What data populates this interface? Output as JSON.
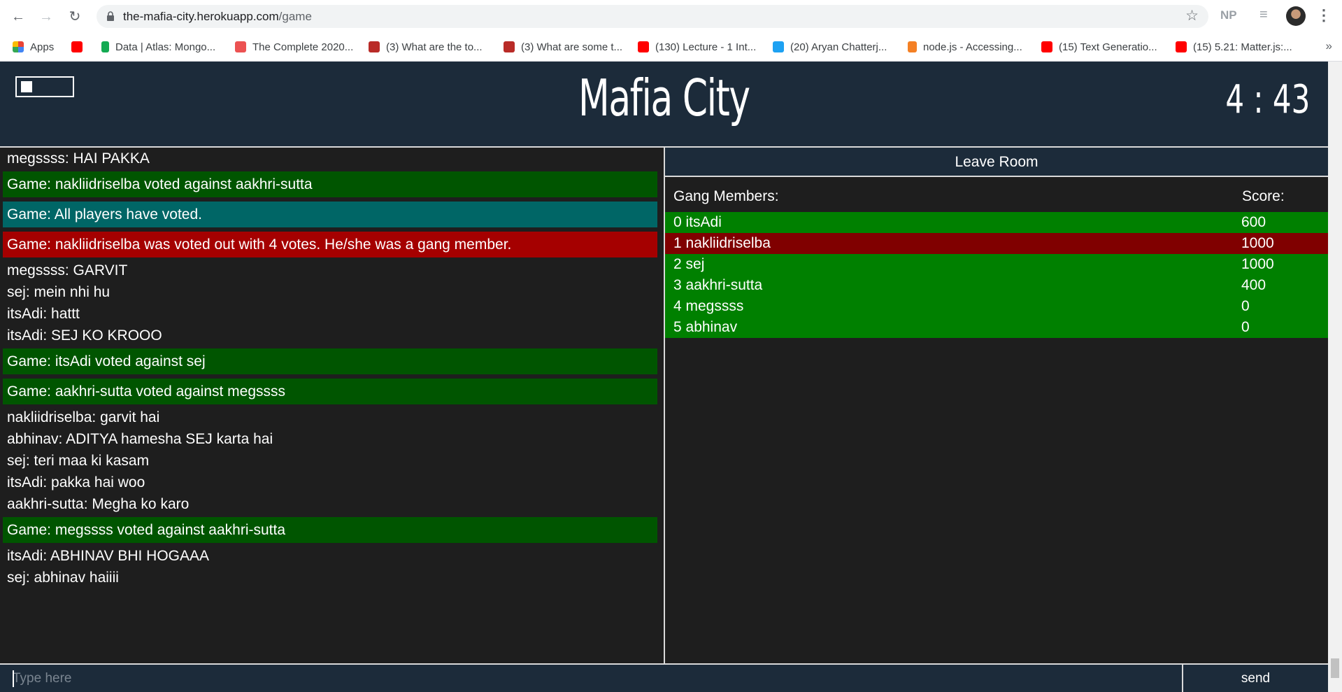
{
  "browser": {
    "url_host": "the-mafia-city.herokuapp.com",
    "url_path": "/game",
    "extension_np": "NP",
    "bookmarks": [
      {
        "label": "Apps",
        "icon": "apps-grid-icon"
      },
      {
        "label": "",
        "icon": "youtube-icon"
      },
      {
        "label": "Data | Atlas: Mongo...",
        "icon": "mongodb-leaf-icon"
      },
      {
        "label": "The Complete 2020...",
        "icon": "udemy-icon"
      },
      {
        "label": "(3) What are the to...",
        "icon": "quora-icon"
      },
      {
        "label": "(3) What are some t...",
        "icon": "quora-icon"
      },
      {
        "label": "(130) Lecture - 1 Int...",
        "icon": "youtube-icon"
      },
      {
        "label": "(20) Aryan Chatterj...",
        "icon": "twitter-icon"
      },
      {
        "label": "node.js - Accessing...",
        "icon": "stackoverflow-icon"
      },
      {
        "label": "(15) Text Generatio...",
        "icon": "youtube-icon"
      },
      {
        "label": "(15) 5.21: Matter.js:...",
        "icon": "youtube-icon"
      }
    ],
    "more": "»"
  },
  "header": {
    "title": "Mafia City",
    "timer": "4 : 43"
  },
  "chat": {
    "messages": [
      {
        "kind": "plain",
        "text": "megssss: HAI PAKKA"
      },
      {
        "kind": "vote",
        "text": "Game: nakliidriselba voted against aakhri-sutta"
      },
      {
        "kind": "info",
        "text": "Game: All players have voted."
      },
      {
        "kind": "out",
        "text": "Game: nakliidriselba was voted out with 4 votes. He/she was a gang member."
      },
      {
        "kind": "plain",
        "text": "megssss: GARVIT"
      },
      {
        "kind": "plain",
        "text": "sej: mein nhi hu"
      },
      {
        "kind": "plain",
        "text": "itsAdi: hattt"
      },
      {
        "kind": "plain",
        "text": "itsAdi: SEJ KO KROOO"
      },
      {
        "kind": "vote",
        "text": "Game: itsAdi voted against sej"
      },
      {
        "kind": "vote",
        "text": "Game: aakhri-sutta voted against megssss"
      },
      {
        "kind": "plain",
        "text": "nakliidriselba: garvit hai"
      },
      {
        "kind": "plain",
        "text": "abhinav: ADITYA hamesha SEJ karta hai"
      },
      {
        "kind": "plain",
        "text": "sej: teri maa ki kasam"
      },
      {
        "kind": "plain",
        "text": "itsAdi: pakka hai woo"
      },
      {
        "kind": "plain",
        "text": "aakhri-sutta: Megha ko karo"
      },
      {
        "kind": "vote",
        "text": "Game: megssss voted against aakhri-sutta"
      },
      {
        "kind": "plain",
        "text": "itsAdi: ABHINAV BHI HOGAAA"
      },
      {
        "kind": "plain",
        "text": "sej: abhinav haiiii"
      }
    ],
    "input_placeholder": "Type here",
    "send_label": "send"
  },
  "sidebar": {
    "leave_label": "Leave Room",
    "members_heading": "Gang Members:",
    "score_heading": "Score:",
    "players": [
      {
        "label": "0 itsAdi",
        "score": "600",
        "alive": true
      },
      {
        "label": "1 nakliidriselba",
        "score": "1000",
        "alive": false
      },
      {
        "label": "2 sej",
        "score": "1000",
        "alive": true
      },
      {
        "label": "3 aakhri-sutta",
        "score": "400",
        "alive": true
      },
      {
        "label": "4 megssss",
        "score": "0",
        "alive": true
      },
      {
        "label": "5 abhinav",
        "score": "0",
        "alive": true
      }
    ]
  },
  "colors": {
    "header_bg": "#1c2b3a",
    "vote_bg": "#005500",
    "info_bg": "#006666",
    "out_bg": "#a50000",
    "alive_bg": "#008000",
    "dead_bg": "#800000"
  }
}
